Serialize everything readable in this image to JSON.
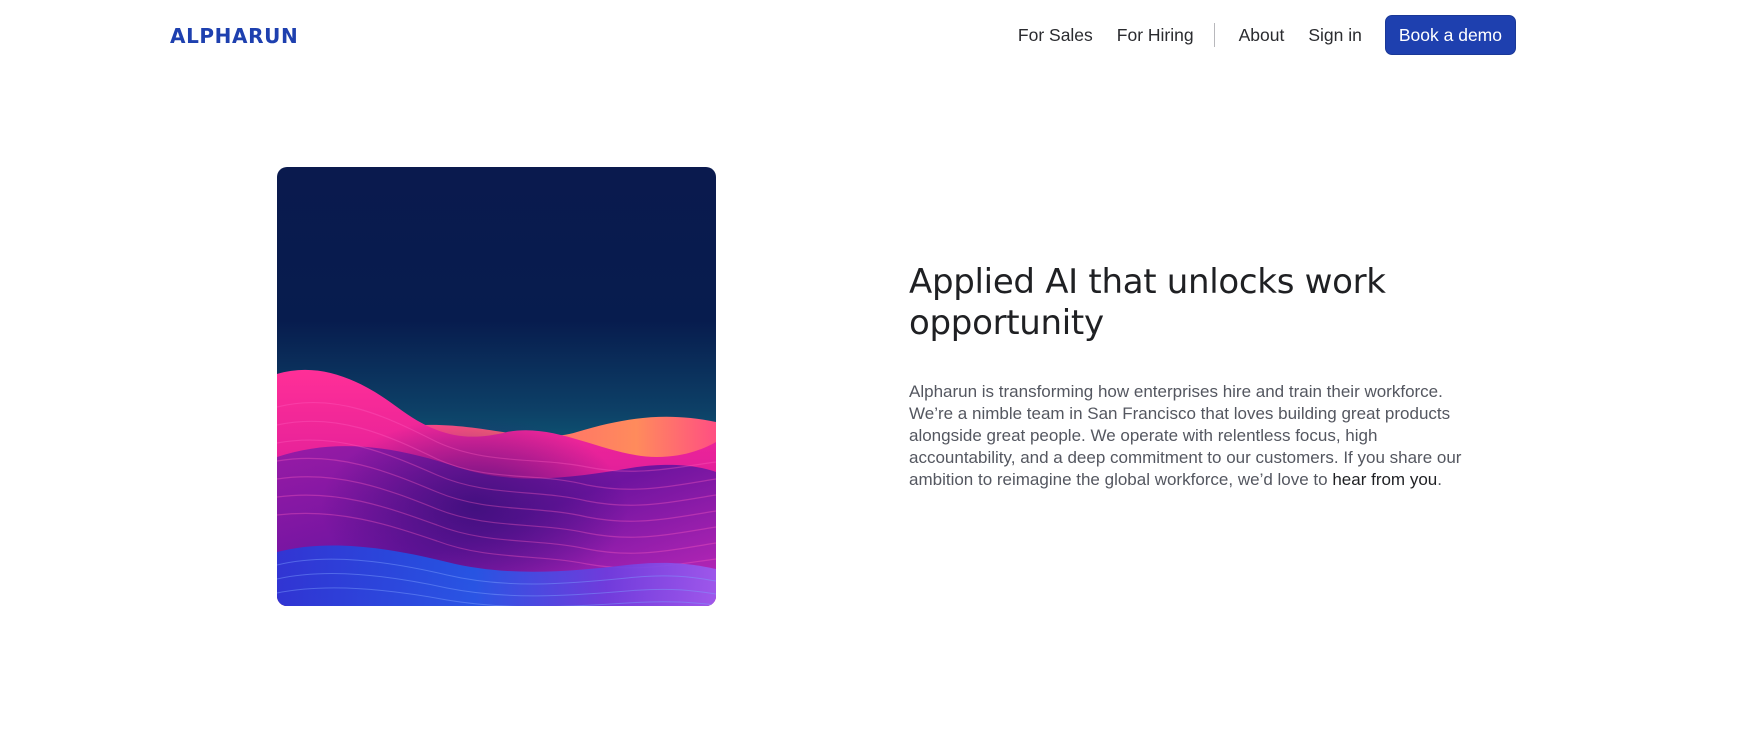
{
  "brand": {
    "logo_text": "ALPHARUN",
    "accent_color": "#1e40af"
  },
  "nav": {
    "for_sales": "For Sales",
    "for_hiring": "For Hiring",
    "about": "About",
    "sign_in": "Sign in",
    "book_demo": "Book a demo"
  },
  "hero": {
    "image_icon": "abstract-wave-illustration",
    "headline": "Applied AI that unlocks work opportunity",
    "body_text": "Alpharun is transforming how enterprises hire and train their workforce. We’re a nimble team in San Francisco that loves building great products alongside great people. We operate with relentless focus, high accountability, and a deep commitment to our customers. If you share our ambition to reimagine the global workforce, we’d love to ",
    "body_link": "hear from you",
    "body_end": "."
  }
}
